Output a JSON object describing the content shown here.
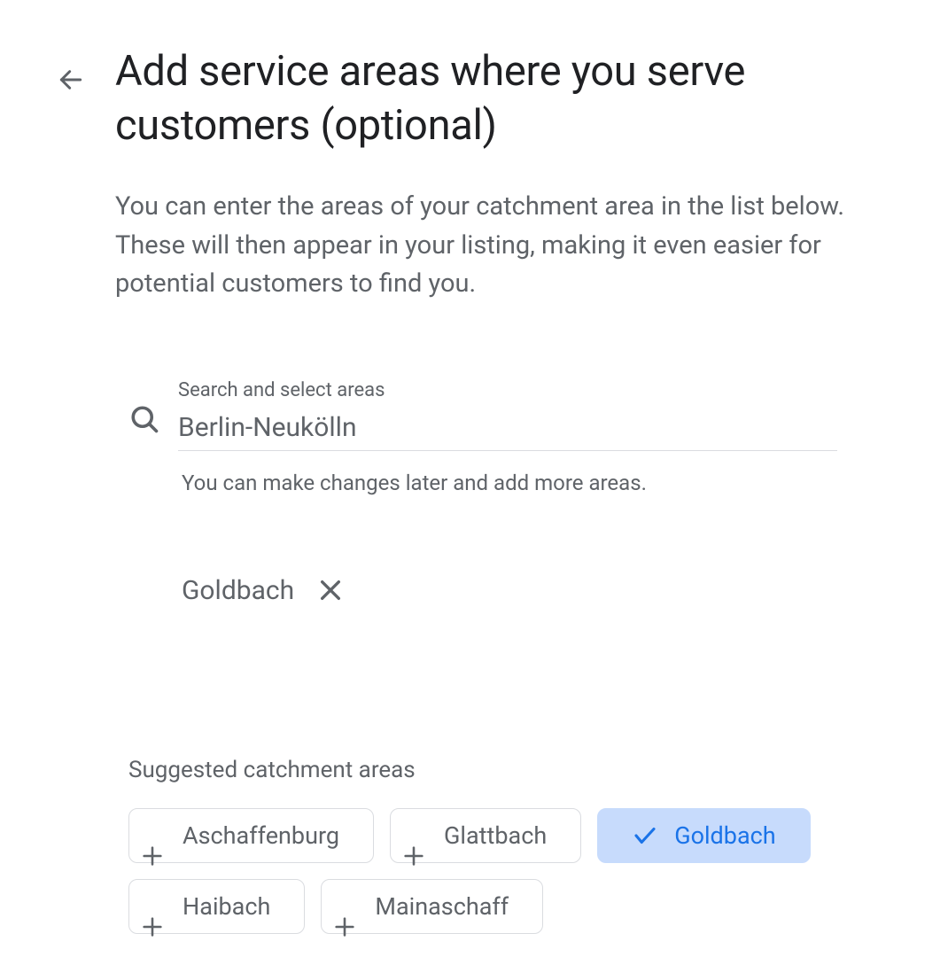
{
  "heading": "Add service areas where you serve customers (optional)",
  "description": "You can enter the areas of your catchment area in the list below. These will then appear in your listing, making it even easier for potential customers to find you.",
  "search": {
    "label": "Search and select areas",
    "value": "Berlin-Neukölln",
    "hint": "You can make changes later and add more areas."
  },
  "selected_area": {
    "label": "Goldbach"
  },
  "suggestions": {
    "title": "Suggested catchment areas",
    "items": [
      {
        "label": "Aschaffenburg",
        "selected": false
      },
      {
        "label": "Glattbach",
        "selected": false
      },
      {
        "label": "Goldbach",
        "selected": true
      },
      {
        "label": "Haibach",
        "selected": false
      },
      {
        "label": "Mainaschaff",
        "selected": false
      }
    ]
  }
}
